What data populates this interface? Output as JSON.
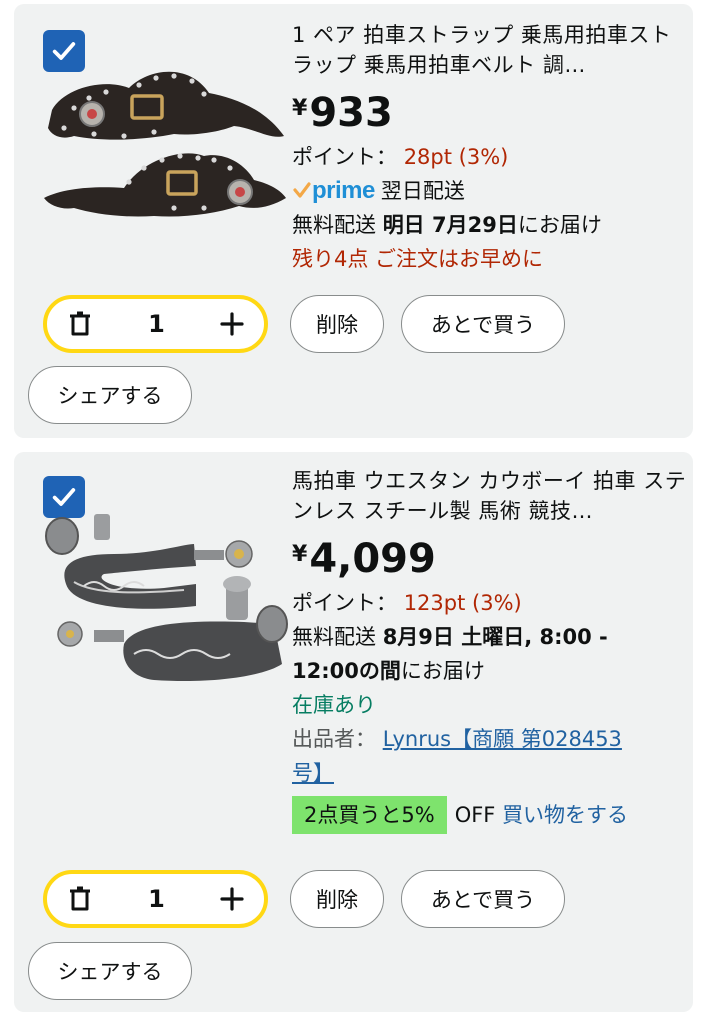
{
  "items": [
    {
      "title": "1 ペア 拍車ストラップ 乗馬用拍車ストラップ 乗馬用拍車ベルト 調…",
      "price_symbol": "¥",
      "price": "933",
      "points_label": "ポイント：",
      "points_value": "28pt (3%)",
      "prime_word": "prime",
      "prime_delivery": "翌日配送",
      "delivery_prefix": "無料配送",
      "delivery_date": "明日 7月29日",
      "delivery_suffix": "にお届け",
      "stock_warning": "残り4点 ご注文はお早めに",
      "quantity": "1",
      "delete_label": "削除",
      "save_later_label": "あとで買う",
      "share_label": "シェアする"
    },
    {
      "title": "馬拍車 ウエスタン カウボーイ 拍車 ステンレス スチール製 馬術 競技…",
      "price_symbol": "¥",
      "price": "4,099",
      "points_label": "ポイント：",
      "points_value": "123pt (3%)",
      "delivery_prefix": "無料配送",
      "delivery_date_line1": "8月9日 土曜日, 8:00 -",
      "delivery_date_line2": "12:00の間",
      "delivery_suffix": "にお届け",
      "stock_status": "在庫あり",
      "seller_label": "出品者：",
      "seller_name_line1": "Lynrus【商願 第028453",
      "seller_name_line2": "号】",
      "promo_badge": "2点買うと5%",
      "promo_off": "OFF",
      "promo_link": "買い物をする",
      "quantity": "1",
      "delete_label": "削除",
      "save_later_label": "あとで買う",
      "share_label": "シェアする"
    }
  ],
  "colors": {
    "card_bg": "#f0f2f2",
    "checkbox": "#1f63b5",
    "stepper_border": "#ffd814",
    "price_red": "#b12704",
    "in_stock_green": "#067d62",
    "link_blue": "#2162a1",
    "prime_blue": "#1f8fd6",
    "promo_green": "#7ee36d"
  },
  "icons": [
    "checkmark-icon",
    "trash-icon",
    "plus-icon",
    "prime-check-icon"
  ]
}
